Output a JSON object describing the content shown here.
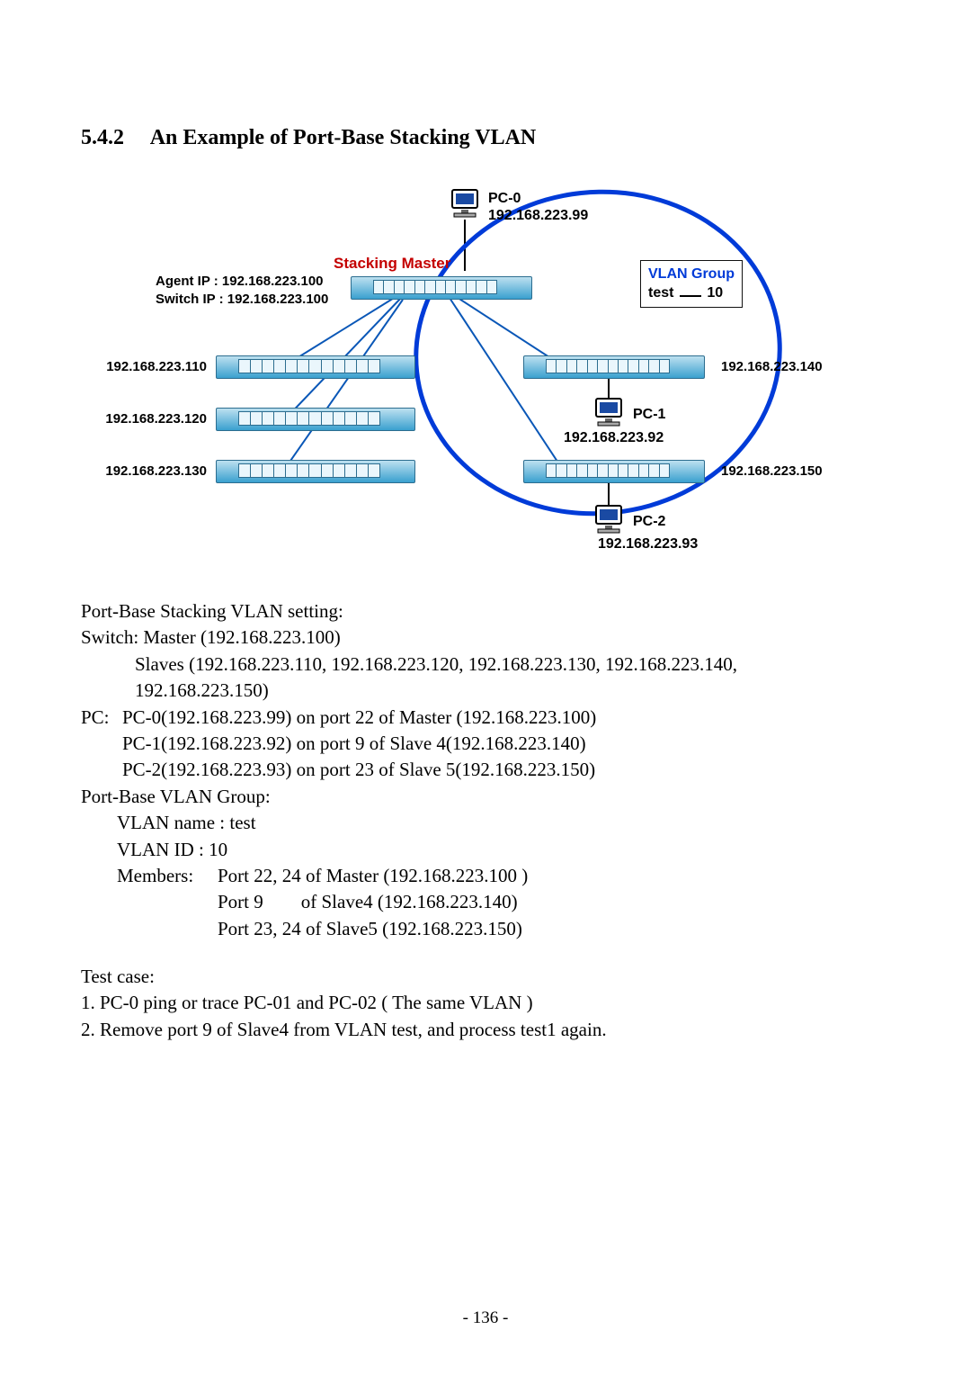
{
  "heading": {
    "number": "5.4.2",
    "title": "An Example of Port-Base Stacking VLAN"
  },
  "diagram": {
    "pc0": {
      "name": "PC-0",
      "ip": "192.168.223.99"
    },
    "pc1": {
      "name": "PC-1",
      "ip": "192.168.223.92"
    },
    "pc2": {
      "name": "PC-2",
      "ip": "192.168.223.93"
    },
    "stacking_master_label": "Stacking Master",
    "agent_ip_label": "Agent IP  : 192.168.223.100",
    "switch_ip_label": "Switch IP : 192.168.223.100",
    "vlan_box_line1": "VLAN Group",
    "vlan_box_line2a": "test",
    "vlan_box_line2b": "10",
    "slave_left": [
      "192.168.223.110",
      "192.168.223.120",
      "192.168.223.130"
    ],
    "slave_right": [
      "192.168.223.140",
      "192.168.223.150"
    ]
  },
  "setting": {
    "title": "Port-Base Stacking VLAN setting:",
    "switch_master": "Switch: Master (192.168.223.100)",
    "slaves_line1": "Slaves (192.168.223.110, 192.168.223.120, 192.168.223.130, 192.168.223.140,",
    "slaves_line2": "192.168.223.150)",
    "pc_prefix": "PC:",
    "pc0": "PC-0(192.168.223.99) on port 22 of Master (192.168.223.100)",
    "pc1": "PC-1(192.168.223.92) on port 9 of Slave 4(192.168.223.140)",
    "pc2": "PC-2(192.168.223.93) on port 23 of Slave 5(192.168.223.150)",
    "vlan_group_title": "Port-Base VLAN Group:",
    "vlan_name": "VLAN name : test",
    "vlan_id": "VLAN ID : 10",
    "members_label": "Members:",
    "members1": "Port 22, 24 of Master (192.168.223.100 )",
    "members2": "Port 9        of Slave4 (192.168.223.140)",
    "members3": "Port 23, 24 of Slave5 (192.168.223.150)"
  },
  "test_case": {
    "title": "Test case:",
    "item1": "1. PC-0 ping or trace PC-01 and PC-02 ( The same VLAN )",
    "item2": "2. Remove port 9 of Slave4 from VLAN test, and process test1 again."
  },
  "page_number": "- 136 -"
}
